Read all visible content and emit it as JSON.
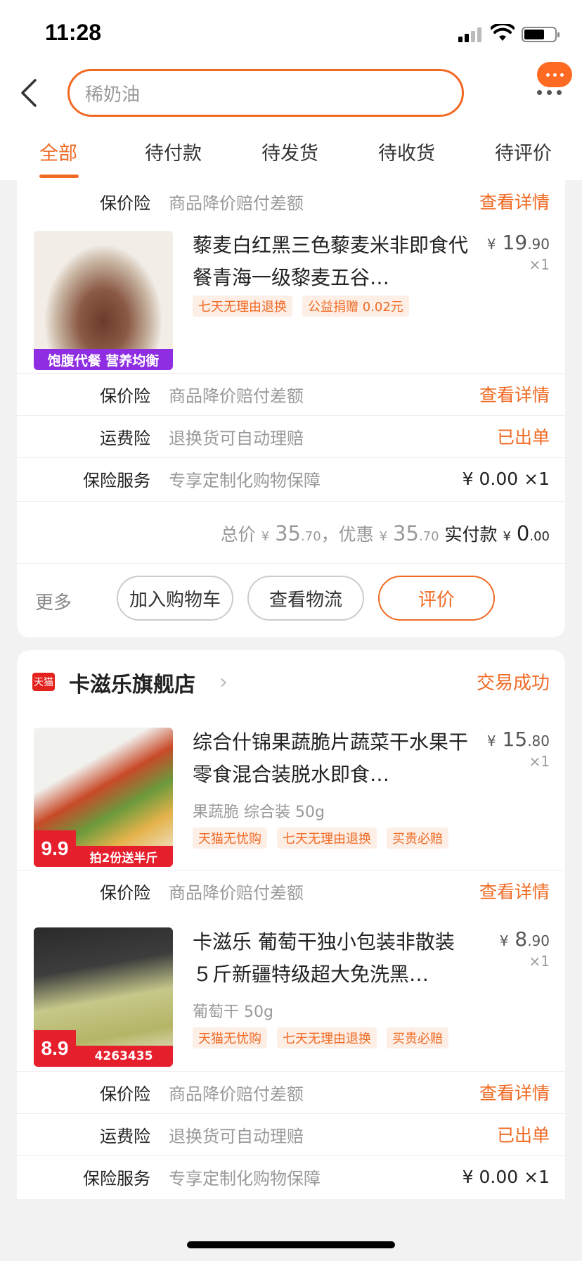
{
  "status_bar": {
    "time": "11:28"
  },
  "search": {
    "query": "稀奶油"
  },
  "tabs": [
    {
      "label": "全部",
      "active": true
    },
    {
      "label": "待付款"
    },
    {
      "label": "待发货"
    },
    {
      "label": "待收货"
    },
    {
      "label": "待评价"
    }
  ],
  "order1": {
    "top_row": {
      "label": "保价险",
      "desc": "商品降价赔付差额",
      "action": "查看详情"
    },
    "product": {
      "title": "藜麦白红黑三色藜麦米非即食代餐青海一级黎麦五谷…",
      "price_symbol": "¥",
      "price_int": "19",
      "price_dec": ".90",
      "qty": "×1",
      "tags": [
        "七天无理由退换",
        "公益捐赠 0.02元"
      ],
      "badge": "饱腹代餐 营养均衡"
    },
    "rows": [
      {
        "label": "保价险",
        "desc": "商品降价赔付差额",
        "action": "查看详情"
      },
      {
        "label": "运费险",
        "desc": "退换货可自动理赔",
        "action": "已出单"
      },
      {
        "label": "保险服务",
        "desc": "专享定制化购物保障",
        "value": "¥ 0.00 ×1"
      }
    ],
    "total": {
      "total_label": "总价",
      "total_int": "35",
      "total_dec": ".70",
      "discount_label": "，优惠",
      "discount_int": "35",
      "discount_dec": ".70",
      "paid_label": "实付款",
      "paid_int": "0",
      "paid_dec": ".00",
      "currency": "¥"
    },
    "buttons": {
      "more": "更多",
      "add_cart": "加入购物车",
      "logistics": "查看物流",
      "review": "评价"
    }
  },
  "order2": {
    "shop": {
      "badge": "天猫",
      "name": "卡滋乐旗舰店",
      "status": "交易成功"
    },
    "product1": {
      "title": "综合什锦果蔬脆片蔬菜干水果干零食混合装脱水即食…",
      "price_symbol": "¥",
      "price_int": "15",
      "price_dec": ".80",
      "qty": "×1",
      "sku": "果蔬脆 综合装 50g",
      "tags": [
        "天猫无忧购",
        "七天无理由退换",
        "买贵必赔"
      ],
      "badge_price": "9.9",
      "badge_text": "拍2份送半斤"
    },
    "product1_row": {
      "label": "保价险",
      "desc": "商品降价赔付差额",
      "action": "查看详情"
    },
    "product2": {
      "title": "卡滋乐 葡萄干独小包装非散装５斤新疆特级超大免洗黑…",
      "price_symbol": "¥",
      "price_int": "8",
      "price_dec": ".90",
      "qty": "×1",
      "sku": "葡萄干 50g",
      "tags": [
        "天猫无忧购",
        "七天无理由退换",
        "买贵必赔"
      ],
      "badge_price": "8.9",
      "badge_text": "4263435"
    },
    "rows": [
      {
        "label": "保价险",
        "desc": "商品降价赔付差额",
        "action": "查看详情"
      },
      {
        "label": "运费险",
        "desc": "退换货可自动理赔",
        "action": "已出单"
      },
      {
        "label": "保险服务",
        "desc": "专享定制化购物保障",
        "value": "¥ 0.00 ×1"
      }
    ]
  },
  "colors": {
    "accent": "#f06a24",
    "tmall_red": "#e4231e"
  }
}
